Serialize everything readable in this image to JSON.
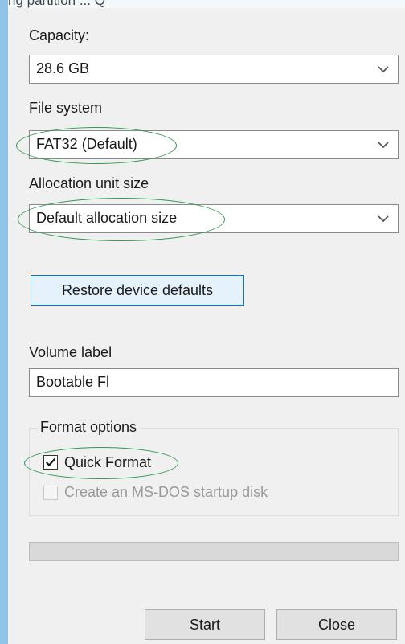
{
  "header_fragment": "ng partition ... Q",
  "capacity": {
    "label": "Capacity:",
    "value": "28.6 GB"
  },
  "file_system": {
    "label": "File system",
    "value": "FAT32 (Default)"
  },
  "allocation": {
    "label": "Allocation unit size",
    "value": "Default allocation size"
  },
  "restore_button": "Restore device defaults",
  "volume_label": {
    "label": "Volume label",
    "value": "Bootable Fl"
  },
  "format_options": {
    "title": "Format options",
    "quick_format": {
      "label": "Quick Format",
      "checked": true
    },
    "msdos_disk": {
      "label": "Create an MS-DOS startup disk",
      "checked": false,
      "enabled": false
    }
  },
  "progress": {
    "value": 0
  },
  "buttons": {
    "start": "Start",
    "close": "Close"
  },
  "colors": {
    "annotation_oval": "#2e9a4e",
    "frame_accent": "#8fc3e8"
  }
}
